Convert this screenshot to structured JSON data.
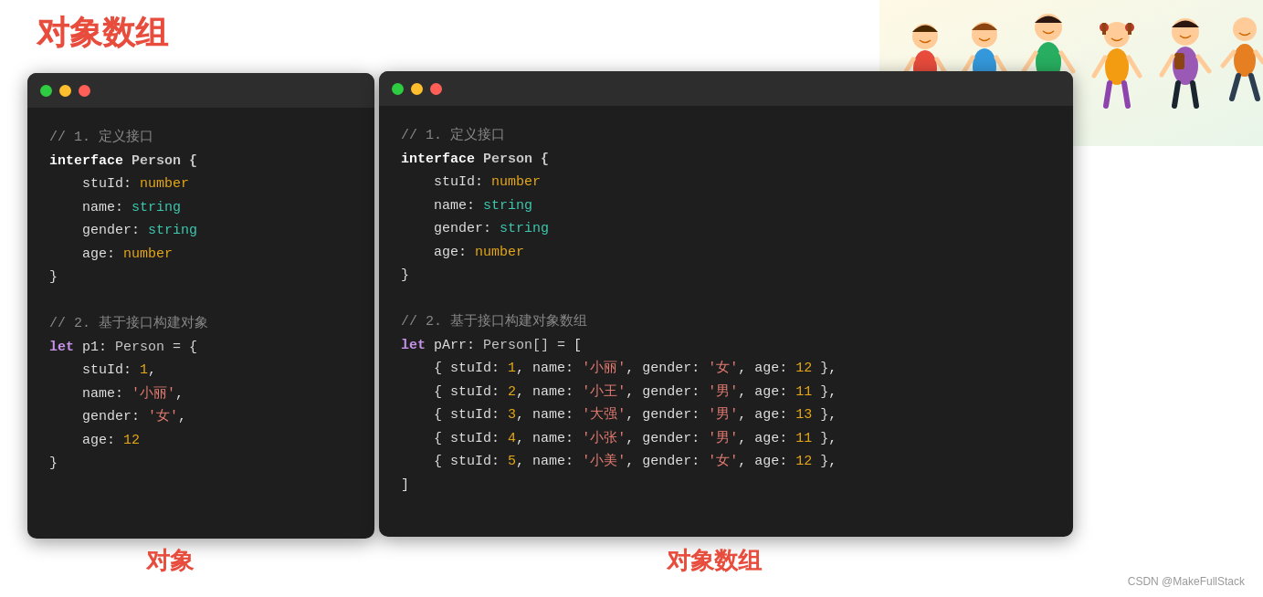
{
  "page": {
    "title": "对象数组",
    "label_object": "对象",
    "label_array": "对象数组",
    "watermark": "CSDN @MakeFullStack"
  },
  "left_window": {
    "comment1": "// 1. 定义接口",
    "interface_keyword": "interface",
    "interface_name": " Person {",
    "props": [
      {
        "name": "stuId",
        "colon": ":",
        "type": "number"
      },
      {
        "name": "name",
        "colon": ":",
        "type": "string"
      },
      {
        "name": "gender",
        "colon": ":",
        "type": "string"
      },
      {
        "name": "age",
        "colon": ":",
        "type": "number"
      }
    ],
    "comment2": "// 2. 基于接口构建对象",
    "let": "let",
    "varname": " p1",
    "colon": ":",
    "person": " Person",
    "assign": " = {",
    "obj_props": [
      {
        "name": "stuId",
        "val": "1,",
        "val_type": "number"
      },
      {
        "name": "name",
        "val": "'小丽',",
        "val_type": "string"
      },
      {
        "name": "gender",
        "val": "'女',",
        "val_type": "string"
      },
      {
        "name": "age",
        "val": "12",
        "val_type": "number"
      }
    ]
  },
  "right_window": {
    "comment1": "// 1. 定义接口",
    "interface_keyword": "interface",
    "interface_name": " Person {",
    "props": [
      {
        "name": "stuId",
        "colon": ":",
        "type": "number"
      },
      {
        "name": "name",
        "colon": ":",
        "type": "string"
      },
      {
        "name": "gender",
        "colon": ":",
        "type": "string"
      },
      {
        "name": "age",
        "colon": ":",
        "type": "number"
      }
    ],
    "comment2": "// 2. 基于接口构建对象数组",
    "let": "let",
    "varname": " pArr",
    "colon": ":",
    "person": " Person[]",
    "assign": " = [",
    "arr_items": [
      {
        "stuId": "1",
        "name": "'小丽'",
        "gender": "'女'",
        "age": "12"
      },
      {
        "stuId": "2",
        "name": "'小王'",
        "gender": "'男'",
        "age": "11"
      },
      {
        "stuId": "3",
        "name": "'大强'",
        "gender": "'男'",
        "age": "13"
      },
      {
        "stuId": "4",
        "name": "'小张'",
        "gender": "'男'",
        "age": "11"
      },
      {
        "stuId": "5",
        "name": "'小美'",
        "gender": "'女'",
        "age": "12"
      }
    ]
  },
  "dots": {
    "green": "#2ecc40",
    "yellow": "#ffbe2e",
    "red": "#ff5f57"
  }
}
